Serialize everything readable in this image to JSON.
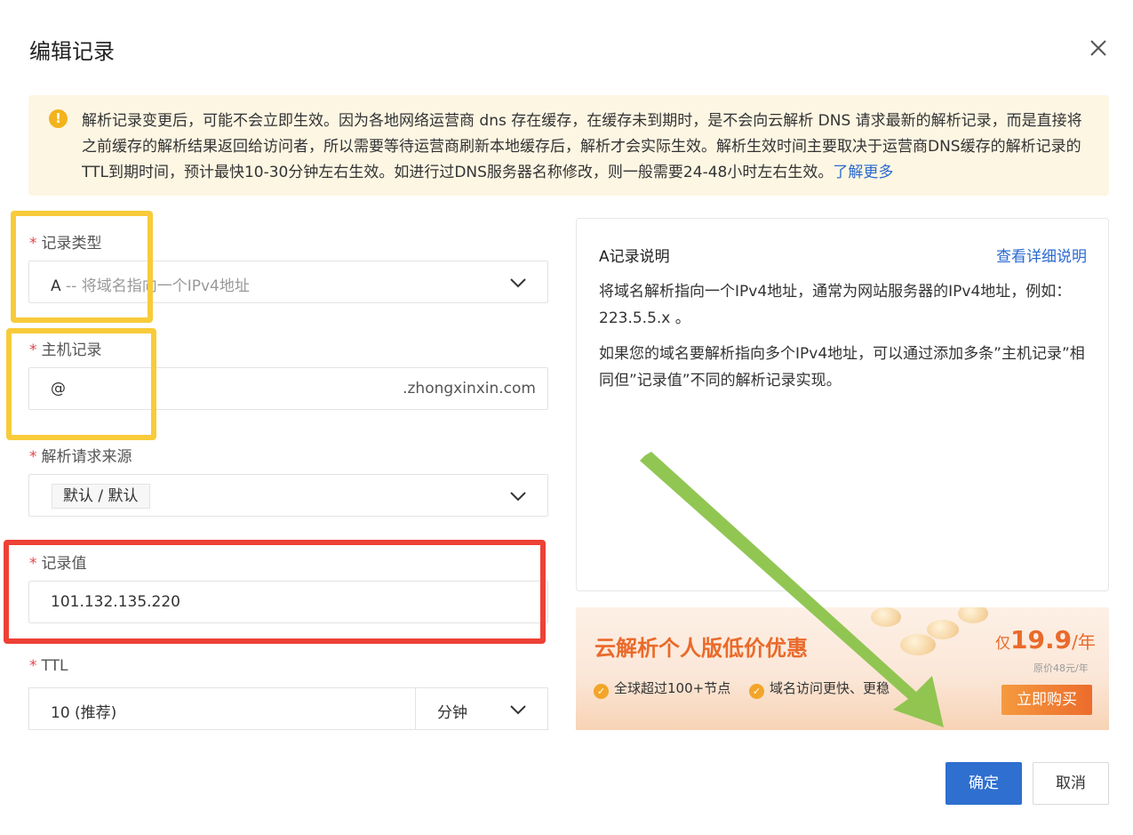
{
  "dialog": {
    "title": "编辑记录",
    "close_icon": "close-icon"
  },
  "notice": {
    "icon": "warning-icon",
    "text": "解析记录变更后，可能不会立即生效。因为各地网络运营商 dns 存在缓存，在缓存未到期时，是不会向云解析 DNS 请求最新的解析记录，而是直接将之前缓存的解析结果返回给访问者，所以需要等待运营商刷新本地缓存后，解析才会实际生效。解析生效时间主要取决于运营商DNS缓存的解析记录的TTL到期时间，预计最快10-30分钟左右生效。如进行过DNS服务器名称修改，则一般需要24-48小时左右生效。",
    "link": "了解更多"
  },
  "form": {
    "required_mark": "*",
    "record_type": {
      "label": "记录类型",
      "value": "A",
      "hint": " -- 将域名指向一个IPv4地址"
    },
    "host": {
      "label": "主机记录",
      "value": "@",
      "suffix": ".zhongxinxin.com"
    },
    "source": {
      "label": "解析请求来源",
      "value": "默认 / 默认"
    },
    "record_value": {
      "label": "记录值",
      "value": "101.132.135.220"
    },
    "ttl": {
      "label": "TTL",
      "value": "10 (推荐)",
      "unit": "分钟"
    }
  },
  "explain": {
    "title": "A记录说明",
    "link": "查看详细说明",
    "p1": "将域名解析指向一个IPv4地址，通常为网站服务器的IPv4地址，例如：223.5.5.x 。",
    "p2": "如果您的域名要解析指向多个IPv4地址，可以通过添加多条”主机记录”相同但”记录值”不同的解析记录实现。"
  },
  "promo": {
    "title": "云解析个人版低价优惠",
    "features": [
      "全球超过100+节点",
      "域名访问更快、更稳"
    ],
    "price_prefix": "仅",
    "price": "19.9",
    "price_unit": "/年",
    "original": "原价48元/年",
    "buy": "立即购买"
  },
  "footer": {
    "ok": "确定",
    "cancel": "取消"
  },
  "colors": {
    "primary": "#2e6fcf",
    "highlight_yellow": "#f8cb3a",
    "highlight_red": "#ee4136",
    "arrow_green": "#8bc34a"
  }
}
